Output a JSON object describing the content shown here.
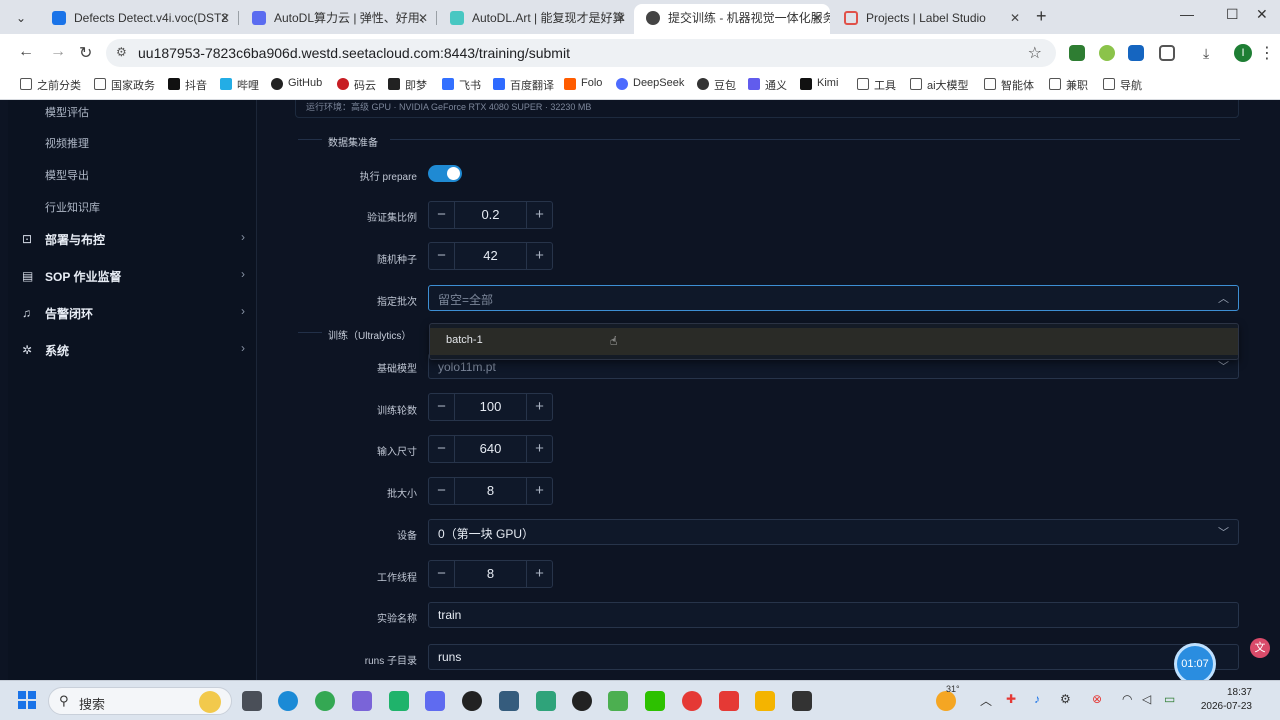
{
  "browser": {
    "tabs": [
      {
        "title": "Defects Detect.v4i.voc(DST2",
        "color": "#1a73e8"
      },
      {
        "title": "AutoDL算力云 | 弹性、好用、",
        "color": "#5b6cf0"
      },
      {
        "title": "AutoDL.Art | 能复现才是好算",
        "color": "#48c7c2"
      },
      {
        "title": "提交训练 - 机器视觉一体化服务",
        "color": "#444444"
      },
      {
        "title": "Projects | Label Studio",
        "color": "#e0524a"
      }
    ],
    "active_tab": 3,
    "url": "uu187953-7823c6ba906d.westd.seetacloud.com:8443/training/submit",
    "bookmarks": [
      {
        "label": "之前分类",
        "folder": true
      },
      {
        "label": "国家政务",
        "folder": true
      },
      {
        "label": "抖音",
        "color": "#111111"
      },
      {
        "label": "哔哩",
        "color": "#23ade5"
      },
      {
        "label": "GitHub",
        "color": "#222222"
      },
      {
        "label": "码云",
        "color": "#c71d23"
      },
      {
        "label": "即梦",
        "color": "#222222"
      },
      {
        "label": "飞书",
        "color": "#3370ff"
      },
      {
        "label": "百度翻译",
        "color": "#2f6bff"
      },
      {
        "label": "Folo",
        "color": "#ff5c00"
      },
      {
        "label": "DeepSeek",
        "color": "#4d6bfe"
      },
      {
        "label": "豆包",
        "color": "#333333"
      },
      {
        "label": "通义",
        "color": "#615ced"
      },
      {
        "label": "Kimi",
        "color": "#111111"
      },
      {
        "label": "工具",
        "folder": true
      },
      {
        "label": "ai大模型",
        "folder": true
      },
      {
        "label": "智能体",
        "folder": true
      },
      {
        "label": "兼职",
        "folder": true
      },
      {
        "label": "导航",
        "folder": true
      }
    ]
  },
  "sidebar": {
    "sub_items": [
      "模型评估",
      "视频推理",
      "模型导出",
      "行业知识库"
    ],
    "groups": [
      {
        "label": "部署与布控",
        "icon": "scan-icon"
      },
      {
        "label": "SOP 作业监督",
        "icon": "document-icon"
      },
      {
        "label": "告警闭环",
        "icon": "bell-icon"
      },
      {
        "label": "系统",
        "icon": "gear-icon"
      }
    ]
  },
  "form": {
    "gpu_info": "运行环境：高级 GPU · NVIDIA GeForce RTX 4080 SUPER · 32230 MB",
    "section_data": "数据集准备",
    "section_train": "训练（Ultralytics）",
    "prepare_label": "执行 prepare",
    "prepare_on": true,
    "val_ratio_label": "验证集比例",
    "val_ratio": "0.2",
    "seed_label": "随机种子",
    "seed": "42",
    "batch_select_label": "指定批次",
    "batch_select_placeholder": "留空=全部",
    "batch_options": [
      "batch-1"
    ],
    "base_model_label": "基础模型",
    "base_model": "yolo11m.pt",
    "epochs_label": "训练轮数",
    "epochs": "100",
    "imgsz_label": "输入尺寸",
    "imgsz": "640",
    "batch_size_label": "批大小",
    "batch_size": "8",
    "device_label": "设备",
    "device": "0（第一块 GPU）",
    "workers_label": "工作线程",
    "workers": "8",
    "exp_name_label": "实验名称",
    "exp_name": "train",
    "runs_dir_label": "runs 子目录",
    "runs_dir": "runs"
  },
  "overlay": {
    "timer": "01:07"
  },
  "taskbar": {
    "search_label": "搜索",
    "weather": "31°",
    "time": "18:37",
    "date": "2026-07-23"
  }
}
